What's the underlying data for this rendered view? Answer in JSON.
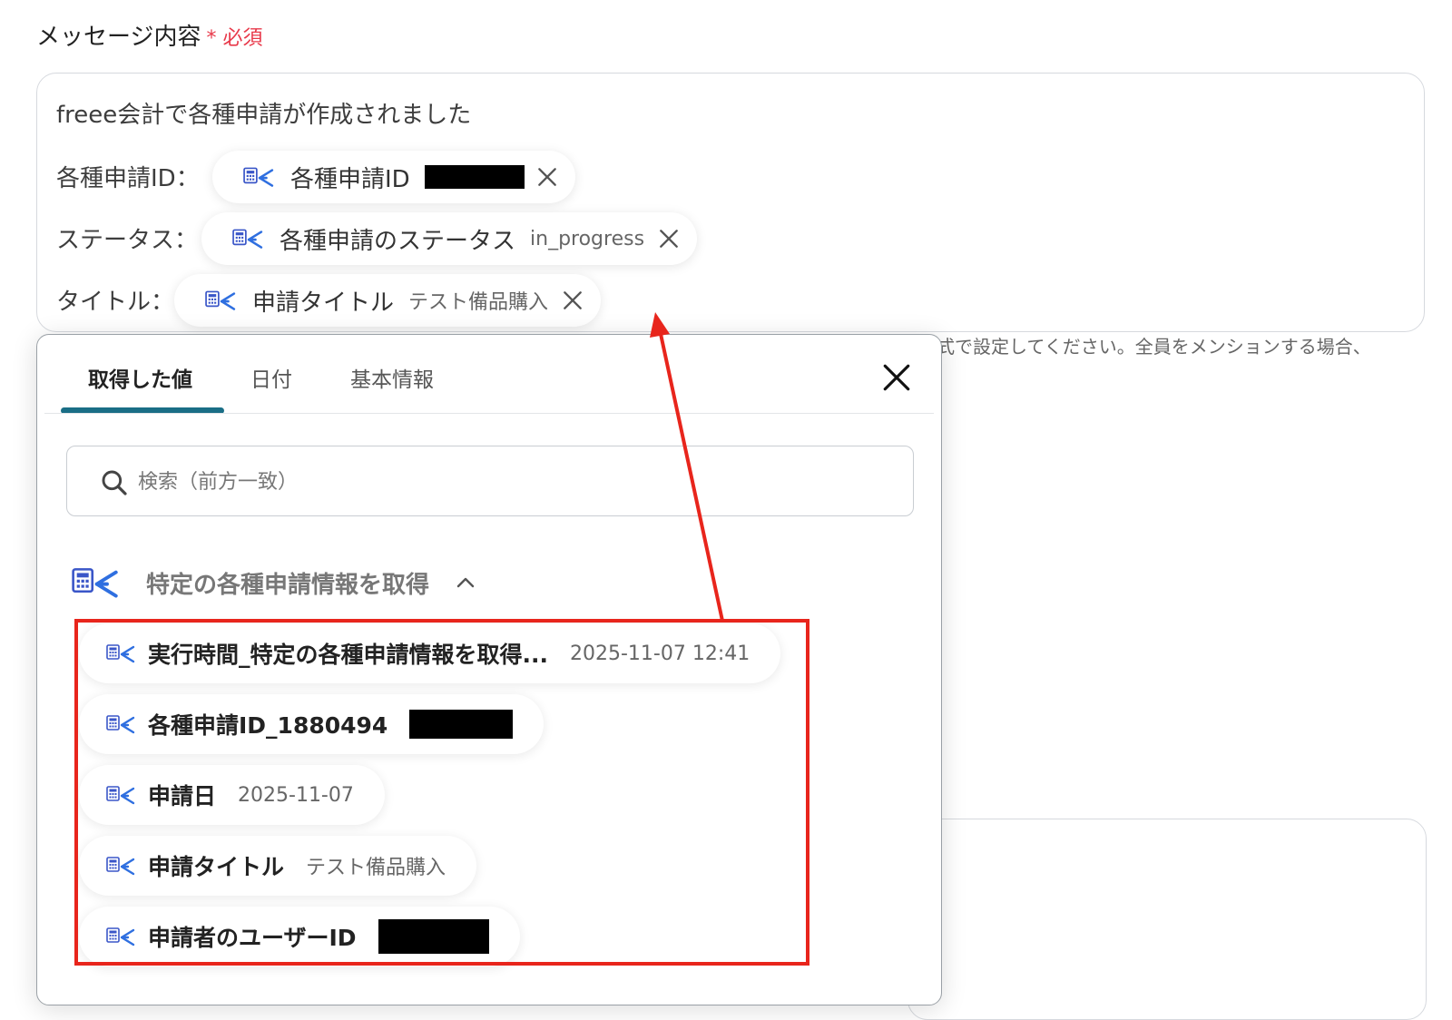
{
  "field": {
    "label": "メッセージ内容",
    "required_mark": "*",
    "required_text": "必須"
  },
  "message": {
    "line1": "freee会計で各種申請が作成されました",
    "rows": [
      {
        "prefix": "各種申請ID：",
        "pill_name": "各種申請ID",
        "pill_value": ""
      },
      {
        "prefix": "ステータス：",
        "pill_name": "各種申請のステータス",
        "pill_value": "in_progress"
      },
      {
        "prefix": "タイトル：",
        "pill_name": "申請タイトル",
        "pill_value": "テスト備品購入"
      }
    ]
  },
  "hint_text": "式で設定してください。全員をメンションする場合、",
  "popup": {
    "tabs": [
      {
        "label": "取得した値"
      },
      {
        "label": "日付"
      },
      {
        "label": "基本情報"
      }
    ],
    "search": {
      "placeholder": "検索（前方一致）"
    },
    "section": {
      "title": "特定の各種申請情報を取得"
    },
    "items": [
      {
        "name": "実行時間_特定の各種申請情報を取得...",
        "value": "2025-11-07 12:41"
      },
      {
        "name": "各種申請ID_1880494",
        "value": ""
      },
      {
        "name": "申請日",
        "value": "2025-11-07"
      },
      {
        "name": "申請タイトル",
        "value": "テスト備品購入"
      },
      {
        "name": "申請者のユーザーID",
        "value": ""
      }
    ]
  },
  "colors": {
    "accent": "#1a6e86",
    "required": "#e8394a",
    "annotation": "#e8251c"
  }
}
